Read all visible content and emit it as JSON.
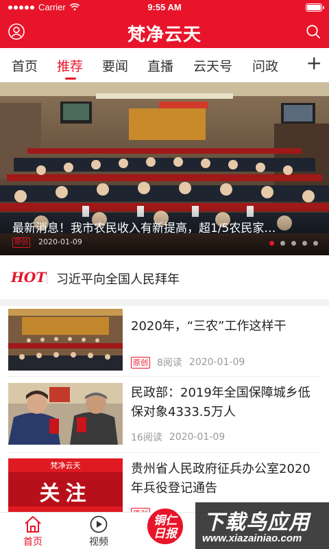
{
  "status_bar": {
    "carrier": "Carrier",
    "time": "9:55 AM"
  },
  "header": {
    "brand": "梵净云天",
    "brand_color": "#e8142a"
  },
  "tabs": {
    "items": [
      {
        "label": "首页",
        "active": false
      },
      {
        "label": "推荐",
        "active": true
      },
      {
        "label": "要闻",
        "active": false
      },
      {
        "label": "直播",
        "active": false
      },
      {
        "label": "云天号",
        "active": false
      },
      {
        "label": "问政",
        "active": false
      }
    ],
    "more_icon": "plus-icon"
  },
  "banner": {
    "title": "最新消息！我市农民收入有新提高，超1/5农民家…",
    "tag": "原创",
    "date": "2020-01-09",
    "pager": {
      "count": 5,
      "current": 1
    }
  },
  "hot": {
    "badge": "HOT",
    "text": "习近平向全国人民拜年"
  },
  "news": [
    {
      "title": "2020年，“三农”工作这样干",
      "tag": "原创",
      "reads": "8阅读",
      "date": "2020-01-09",
      "thumb_icon": "conference-photo"
    },
    {
      "title": "民政部：2019年全国保障城乡低保对象4333.5万人",
      "tag": "",
      "reads": "16阅读",
      "date": "2020-01-09",
      "thumb_icon": "people-photo"
    },
    {
      "title": "贵州省人民政府征兵办公室2020年兵役登记通告",
      "tag": "原创",
      "reads": "阅读",
      "date": "",
      "thumb_icon": "attention-graphic",
      "thumb_text": "关注",
      "thumb_brand": "梵净云天"
    }
  ],
  "bottom_nav": {
    "items": [
      {
        "label": "首页",
        "icon": "home-icon",
        "active": true
      },
      {
        "label": "视频",
        "icon": "play-icon",
        "active": false
      }
    ],
    "center_logo": {
      "line1": "铜仁",
      "line2": "日报"
    }
  },
  "watermark": {
    "big": "下载鸟应用",
    "small": "www.xiazainiao.com"
  }
}
